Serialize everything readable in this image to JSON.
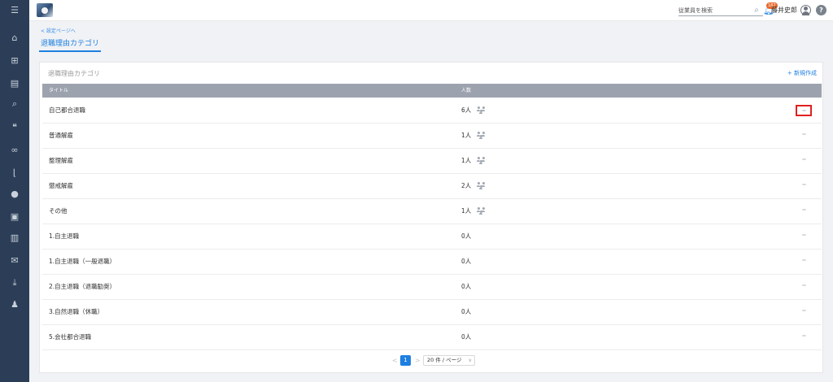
{
  "sidebar": {
    "items": [
      {
        "icon": "menu-icon",
        "glyph": "☰"
      },
      {
        "icon": "home-icon",
        "glyph": "⌂"
      },
      {
        "icon": "org-chart-icon",
        "glyph": "⊞"
      },
      {
        "icon": "document-icon",
        "glyph": "▤"
      },
      {
        "icon": "search-icon",
        "glyph": "⌕"
      },
      {
        "icon": "chat-icon",
        "glyph": "❝"
      },
      {
        "icon": "link-icon",
        "glyph": "∞"
      },
      {
        "icon": "chart-icon",
        "glyph": "⌊"
      },
      {
        "icon": "info-icon",
        "glyph": "●"
      },
      {
        "icon": "contact-card-icon",
        "glyph": "▣"
      },
      {
        "icon": "book-icon",
        "glyph": "▥"
      },
      {
        "icon": "mail-icon",
        "glyph": "✉"
      },
      {
        "icon": "download-icon",
        "glyph": "⤓"
      },
      {
        "icon": "user-settings-icon",
        "glyph": "♟"
      }
    ]
  },
  "header": {
    "search_placeholder": "従業員を検索",
    "notification_count": "187",
    "username": "藤井史郎",
    "help_glyph": "?"
  },
  "breadcrumb": {
    "back_label": "< 設定ページへ"
  },
  "page": {
    "title": "退職理由カテゴリ"
  },
  "card": {
    "title": "退職理由カテゴリ",
    "new_button": "+ 新規作成",
    "columns": {
      "title": "タイトル",
      "count": "人数"
    },
    "rows": [
      {
        "title": "自己都合退職",
        "count": "6人",
        "has_people_icon": true,
        "highlighted": true
      },
      {
        "title": "普通解雇",
        "count": "1人",
        "has_people_icon": true,
        "highlighted": false
      },
      {
        "title": "整理解雇",
        "count": "1人",
        "has_people_icon": true,
        "highlighted": false
      },
      {
        "title": "懲戒解雇",
        "count": "2人",
        "has_people_icon": true,
        "highlighted": false
      },
      {
        "title": "その他",
        "count": "1人",
        "has_people_icon": true,
        "highlighted": false
      },
      {
        "title": "1.自主退職",
        "count": "0人",
        "has_people_icon": false,
        "highlighted": false
      },
      {
        "title": "1.自主退職（一般退職）",
        "count": "0人",
        "has_people_icon": false,
        "highlighted": false
      },
      {
        "title": "2.自主退職（退職勧奨）",
        "count": "0人",
        "has_people_icon": false,
        "highlighted": false
      },
      {
        "title": "3.自然退職（休職）",
        "count": "0人",
        "has_people_icon": false,
        "highlighted": false
      },
      {
        "title": "5.会社都合退職",
        "count": "0人",
        "has_people_icon": false,
        "highlighted": false
      }
    ],
    "more_glyph": "···"
  },
  "pagination": {
    "prev": "<",
    "current_page": "1",
    "next": ">",
    "page_size": "20 件 / ページ",
    "caret": "∨"
  },
  "colors": {
    "sidebar_bg": "#2c3e57",
    "accent": "#1e7fe0",
    "table_header": "#9da3ae",
    "highlight_border": "#e02020",
    "badge": "#e8692d"
  }
}
